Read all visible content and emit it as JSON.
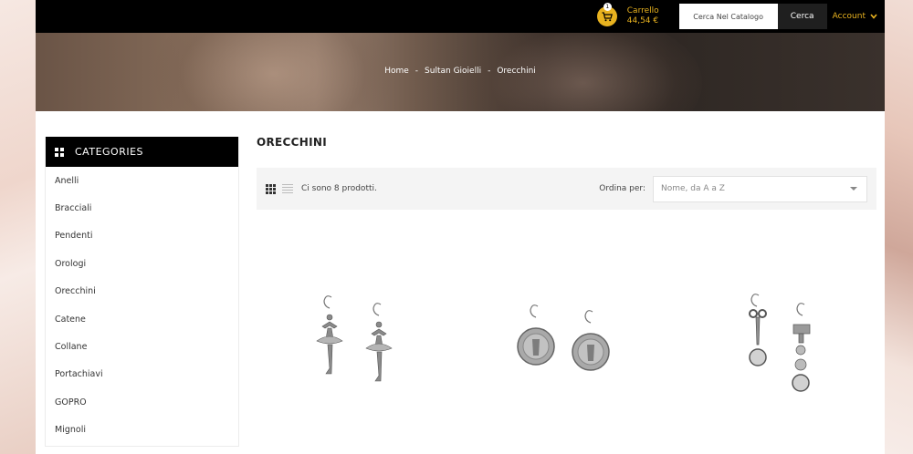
{
  "header": {
    "cart": {
      "label": "Carrello",
      "total": "44,54 €",
      "badge": "1"
    },
    "search": {
      "placeholder": "Cerca Nel Catalogo",
      "button": "Cerca"
    },
    "account": {
      "label": "Account"
    }
  },
  "breadcrumb": [
    "Home",
    "Sultan Gioielli",
    "Orecchini"
  ],
  "breadcrumb_sep": "-",
  "sidebar": {
    "title": "CATEGORIES",
    "items": [
      "Anelli",
      "Bracciali",
      "Pendenti",
      "Orologi",
      "Orecchini",
      "Catene",
      "Collane",
      "Portachiavi",
      "GOPRO",
      "Mignoli"
    ]
  },
  "main": {
    "title": "ORECCHINI",
    "count": "Ci sono 8 prodotti.",
    "sort_label": "Ordina per:",
    "sort_value": "Nome, da A a Z"
  },
  "colors": {
    "accent": "#e8b21f",
    "topbar": "#000000"
  },
  "icons": {
    "cart": "cart-icon",
    "search": "search-icon",
    "chevron": "chevron-down-icon",
    "grid_view": "grid-view-icon",
    "list_view": "list-view-icon"
  }
}
